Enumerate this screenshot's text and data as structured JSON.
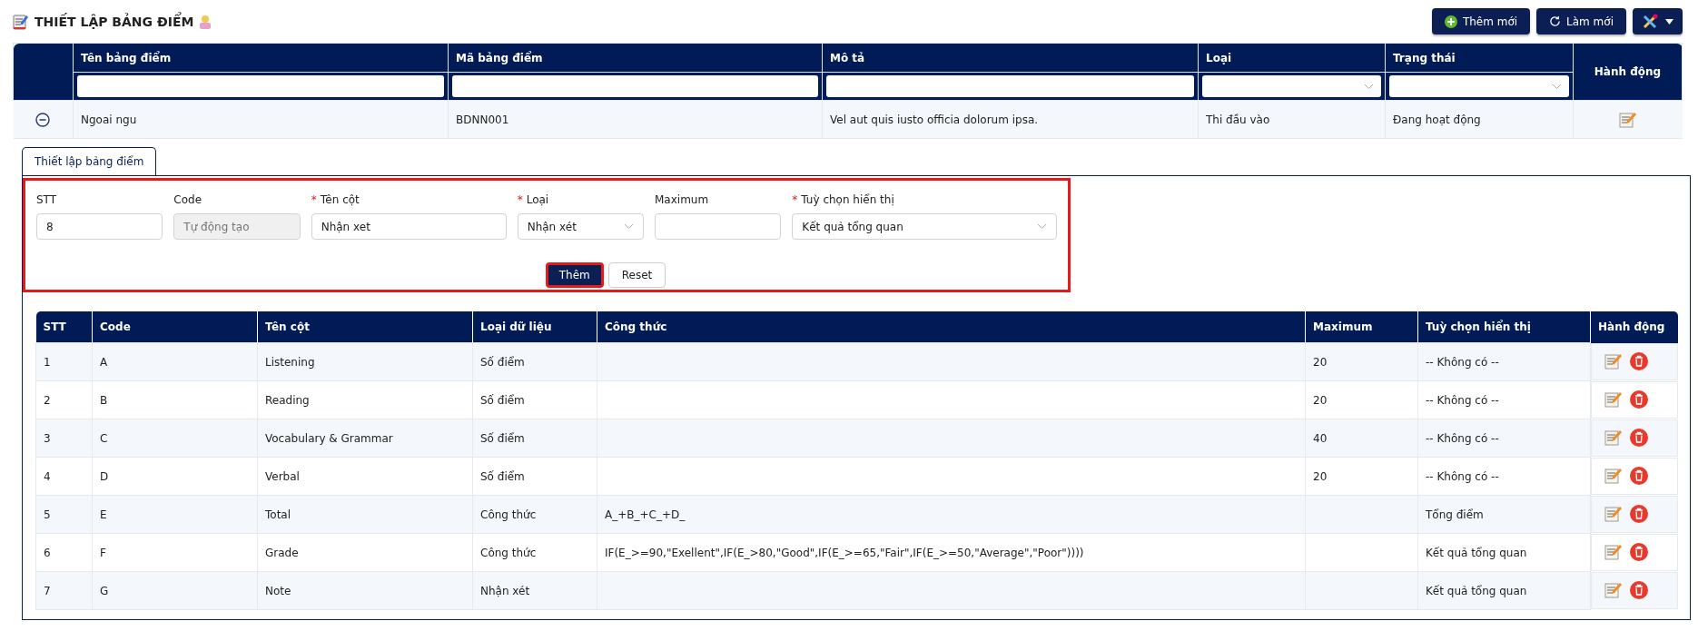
{
  "page": {
    "title": "THIẾT LẬP BẢNG ĐIỂM"
  },
  "toolbar": {
    "buttons": [
      {
        "kind": "add",
        "label": "Thêm mới"
      },
      {
        "kind": "refresh",
        "label": "Làm mới"
      },
      {
        "kind": "tools"
      }
    ]
  },
  "table": {
    "columns": [
      {
        "label": "Tên bảng điểm",
        "kind": "text"
      },
      {
        "label": "Mã bảng điểm",
        "kind": "text"
      },
      {
        "label": "Mô tả",
        "kind": "text"
      },
      {
        "label": "Loại",
        "kind": "select"
      },
      {
        "label": "Trạng thái",
        "kind": "select"
      }
    ],
    "action_column": "Hành động",
    "rows": [
      {
        "expanded": true,
        "cells": [
          "Ngoai ngu",
          "BDNN001",
          "Vel aut quis iusto officia dolorum ipsa.",
          "Thi đầu vào",
          "Đang hoạt động"
        ]
      }
    ]
  },
  "detail": {
    "tabs": [
      {
        "label": "Thiết lập bảng điểm",
        "selected": true
      }
    ],
    "form": {
      "fields": [
        {
          "label": "STT",
          "kind": "input",
          "value": "8"
        },
        {
          "label": "Code",
          "kind": "disabled",
          "placeholder": "Tự động tạo"
        },
        {
          "required_mark": "*",
          "label": "Tên cột",
          "kind": "input",
          "value": "Nhận xet"
        },
        {
          "required_mark": "*",
          "label": "Loại",
          "kind": "select",
          "value": "Nhận xét"
        },
        {
          "label": "Maximum",
          "kind": "input"
        },
        {
          "required_mark": "*",
          "label": "Tuỳ chọn hiển thị",
          "kind": "select",
          "value": "Kết quả tổng quan"
        }
      ],
      "buttons": [
        {
          "kind": "primary",
          "label": "Thêm"
        },
        {
          "kind": "secondary",
          "label": "Reset"
        }
      ]
    },
    "table": {
      "columns": [
        "STT",
        "Code",
        "Tên cột",
        "Loại dữ liệu",
        "Công thức",
        "Maximum",
        "Tuỳ chọn hiển thị",
        "Hành động"
      ],
      "rows": [
        [
          "1",
          "A",
          "Listening",
          "Số điểm",
          "",
          "20",
          "-- Không có --"
        ],
        [
          "2",
          "B",
          "Reading",
          "Số điểm",
          "",
          "20",
          "-- Không có --"
        ],
        [
          "3",
          "C",
          "Vocabulary & Grammar",
          "Số điểm",
          "",
          "40",
          "-- Không có --"
        ],
        [
          "4",
          "D",
          "Verbal",
          "Số điểm",
          "",
          "20",
          "-- Không có --"
        ],
        [
          "5",
          "E",
          "Total",
          "Công thức",
          "A_+B_+C_+D_",
          "",
          "Tổng điểm"
        ],
        [
          "6",
          "F",
          "Grade",
          "Công thức",
          "IF(E_>=90,\"Exellent\",IF(E_>80,\"Good\",IF(E_>=65,\"Fair\",IF(E_>=50,\"Average\",\"Poor\"))))",
          "",
          "Kết quả tổng quan"
        ],
        [
          "7",
          "G",
          "Note",
          "Nhận xét",
          "",
          "",
          "Kết quả tổng quan"
        ]
      ]
    }
  }
}
